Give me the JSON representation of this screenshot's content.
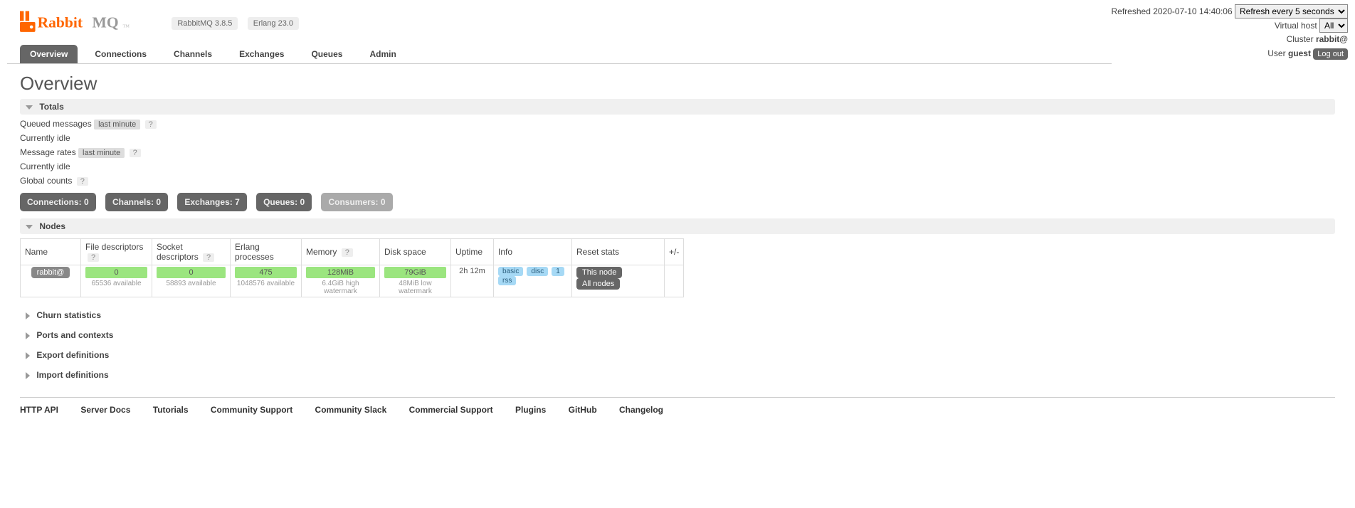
{
  "header": {
    "refreshed_label": "Refreshed",
    "refresh_time": "2020-07-10 14:40:06",
    "refresh_select": "Refresh every 5 seconds",
    "vhost_label": "Virtual host",
    "vhost_value": "All",
    "cluster_label": "Cluster",
    "cluster_value": "rabbit@",
    "user_label": "User",
    "user_value": "guest",
    "logout": "Log out",
    "rabbitmq_version": "RabbitMQ 3.8.5",
    "erlang_version": "Erlang 23.0",
    "logo_orange": "Rabbit",
    "logo_gray": "MQ",
    "logo_tm": "TM"
  },
  "tabs": {
    "overview": "Overview",
    "connections": "Connections",
    "channels": "Channels",
    "exchanges": "Exchanges",
    "queues": "Queues",
    "admin": "Admin"
  },
  "page": {
    "title": "Overview"
  },
  "sections": {
    "totals": "Totals",
    "nodes": "Nodes",
    "churn": "Churn statistics",
    "ports": "Ports and contexts",
    "export": "Export definitions",
    "import": "Import definitions"
  },
  "totals": {
    "queued_label": "Queued messages",
    "last_minute": "last minute",
    "help": "?",
    "idle1": "Currently idle",
    "rates_label": "Message rates",
    "idle2": "Currently idle",
    "globals_label": "Global counts",
    "counts": {
      "connections": "Connections: 0",
      "channels": "Channels: 0",
      "exchanges": "Exchanges: 7",
      "queues": "Queues: 0",
      "consumers": "Consumers: 0"
    }
  },
  "nodes_table": {
    "headers": {
      "name": "Name",
      "fd": "File descriptors",
      "sd": "Socket descriptors",
      "ep": "Erlang processes",
      "mem": "Memory",
      "disk": "Disk space",
      "uptime": "Uptime",
      "info": "Info",
      "reset": "Reset stats",
      "plusminus": "+/-"
    },
    "row": {
      "name": "rabbit@             ",
      "fd_val": "0",
      "fd_sub": "65536 available",
      "sd_val": "0",
      "sd_sub": "58893 available",
      "ep_val": "475",
      "ep_sub": "1048576 available",
      "mem_val": "128MiB",
      "mem_sub": "6.4GiB high watermark",
      "disk_val": "79GiB",
      "disk_sub": "48MiB low watermark",
      "uptime": "2h 12m",
      "info_basic": "basic",
      "info_disc": "disc",
      "info_one": "1",
      "info_rss": "rss",
      "reset_this": "This node",
      "reset_all": "All nodes"
    }
  },
  "footer": {
    "http_api": "HTTP API",
    "server_docs": "Server Docs",
    "tutorials": "Tutorials",
    "community_support": "Community Support",
    "community_slack": "Community Slack",
    "commercial_support": "Commercial Support",
    "plugins": "Plugins",
    "github": "GitHub",
    "changelog": "Changelog"
  }
}
